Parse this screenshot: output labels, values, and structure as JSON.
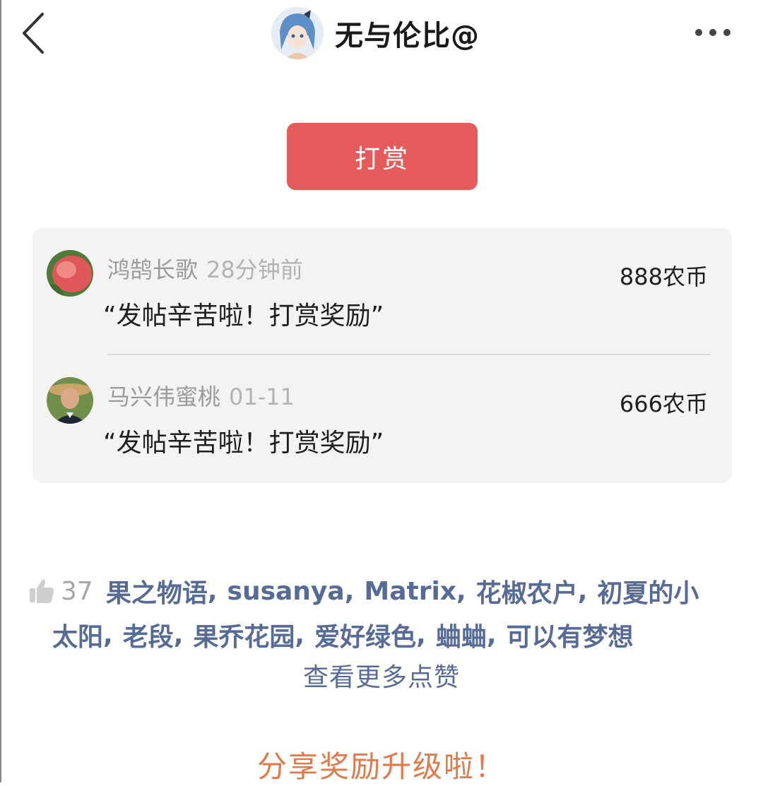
{
  "header": {
    "back_icon": "chevron-left-icon",
    "author_name": "无与伦比@",
    "more_icon": "more-horizontal-icon"
  },
  "reward_button": {
    "label": "打赏",
    "color": "#e55a5a"
  },
  "rewards": [
    {
      "name": "鸿鹄长歌",
      "time": "28分钟前",
      "message": "“发帖辛苦啦！打赏奖励”",
      "amount": "888农币"
    },
    {
      "name": "马兴伟蜜桃",
      "time": "01-11",
      "message": "“发帖辛苦啦！打赏奖励”",
      "amount": "666农币"
    }
  ],
  "likes": {
    "icon": "thumbs-up-icon",
    "count": "37",
    "line1": [
      "果之物语",
      "susanya",
      "Matrix",
      "花椒农户",
      "初夏的小"
    ],
    "line2": [
      "太阳",
      "老段",
      "果乔花园",
      "爱好绿色",
      "蛐蛐",
      "可以有梦想"
    ],
    "more_label": "查看更多点赞",
    "link_color": "#566b95"
  },
  "share_promo": {
    "label": "分享奖励升级啦！",
    "color": "#e07a4a"
  }
}
